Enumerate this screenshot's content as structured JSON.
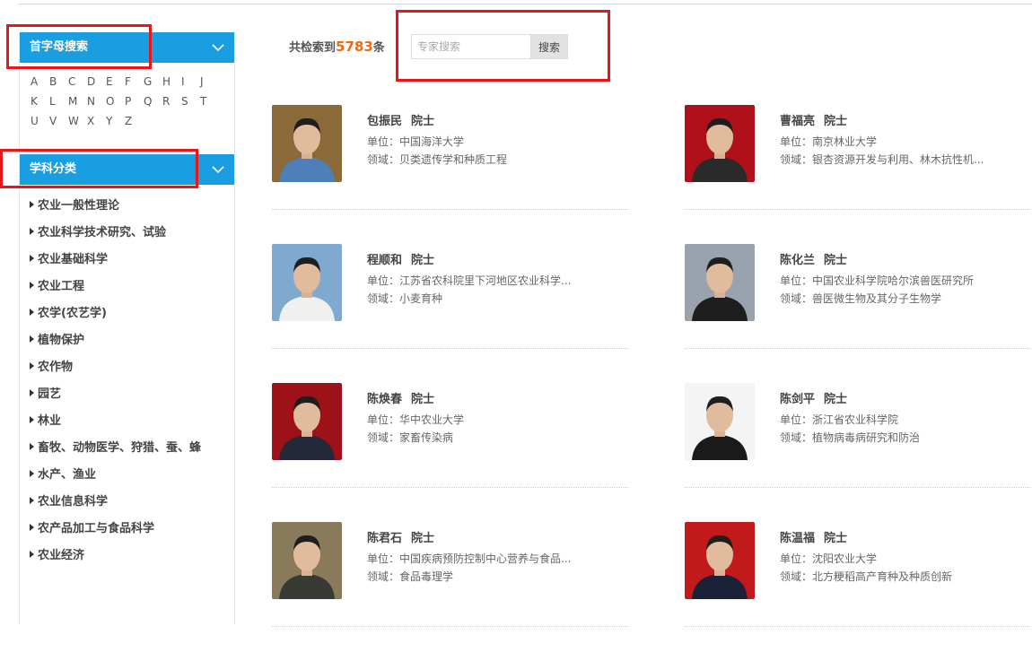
{
  "letter_search": {
    "title": "首字母搜索",
    "letters": [
      "A",
      "B",
      "C",
      "D",
      "E",
      "F",
      "G",
      "H",
      "I",
      "J",
      "K",
      "L",
      "M",
      "N",
      "O",
      "P",
      "Q",
      "R",
      "S",
      "T",
      "U",
      "V",
      "W",
      "X",
      "Y",
      "Z"
    ]
  },
  "category": {
    "title": "学科分类",
    "items": [
      "农业一般性理论",
      "农业科学技术研究、试验",
      "农业基础科学",
      "农业工程",
      "农学(农艺学)",
      "植物保护",
      "农作物",
      "园艺",
      "林业",
      "畜牧、动物医学、狩猎、蚕、蜂",
      "水产、渔业",
      "农业信息科学",
      "农产品加工与食品科学",
      "农业经济"
    ]
  },
  "result": {
    "prefix": "共检索到",
    "count": "5783",
    "suffix": "条"
  },
  "search": {
    "placeholder": "专家搜索",
    "button": "搜索"
  },
  "experts": [
    {
      "name": "包振民",
      "title": "院士",
      "unit": "单位：中国海洋大学",
      "field": "领域：贝类遗传学和种质工程",
      "photo_bg": "#8b6a3a",
      "shirt": "#4f7fb8"
    },
    {
      "name": "曹福亮",
      "title": "院士",
      "unit": "单位：南京林业大学",
      "field": "领域：银杏资源开发与利用、林木抗性机...",
      "photo_bg": "#b0101a",
      "shirt": "#2a2a2a"
    },
    {
      "name": "程顺和",
      "title": "院士",
      "unit": "单位：江苏省农科院里下河地区农业科学...",
      "field": "领域：小麦育种",
      "photo_bg": "#7fa9cf",
      "shirt": "#f0f0ee"
    },
    {
      "name": "陈化兰",
      "title": "院士",
      "unit": "单位：中国农业科学院哈尔滨兽医研究所",
      "field": "领域：兽医微生物及其分子生物学",
      "photo_bg": "#9aa3ad",
      "shirt": "#1e1e1e"
    },
    {
      "name": "陈焕春",
      "title": "院士",
      "unit": "单位：华中农业大学",
      "field": "领域：家畜传染病",
      "photo_bg": "#9c1218",
      "shirt": "#23283a"
    },
    {
      "name": "陈剑平",
      "title": "院士",
      "unit": "单位：浙江省农业科学院",
      "field": "领域：植物病毒病研究和防治",
      "photo_bg": "#f4f4f4",
      "shirt": "#1a1a1a"
    },
    {
      "name": "陈君石",
      "title": "院士",
      "unit": "单位：中国疾病预防控制中心营养与食品...",
      "field": "领域：食品毒理学",
      "photo_bg": "#8a7a5c",
      "shirt": "#3a3a34"
    },
    {
      "name": "陈温福",
      "title": "院士",
      "unit": "单位：沈阳农业大学",
      "field": "领域：北方粳稻高产育种及种质创新",
      "photo_bg": "#c01a1a",
      "shirt": "#1b2238"
    }
  ]
}
